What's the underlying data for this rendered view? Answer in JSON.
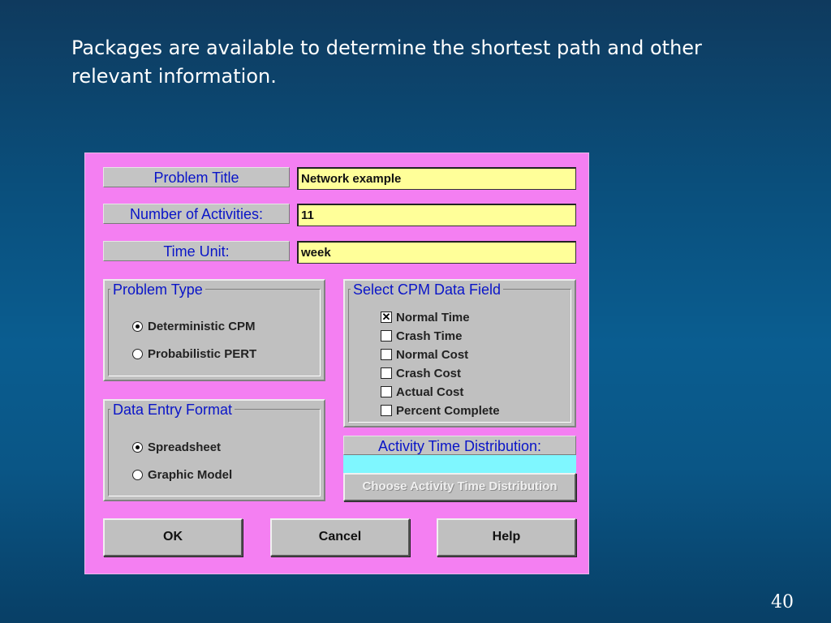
{
  "slide": {
    "text": "Packages are available to determine the shortest path and other relevant information.",
    "page_number": "40"
  },
  "dialog": {
    "problem_title_label": "Problem Title",
    "problem_title_value": "Network example",
    "num_activities_label": "Number of Activities:",
    "num_activities_value": "11",
    "time_unit_label": "Time Unit:",
    "time_unit_value": "week",
    "problem_type": {
      "title": "Problem Type",
      "options": [
        "Deterministic CPM",
        "Probabilistic PERT"
      ],
      "selected": "Deterministic CPM"
    },
    "cpm_data_field": {
      "title": "Select CPM Data Field",
      "options": [
        "Normal Time",
        "Crash Time",
        "Normal Cost",
        "Crash Cost",
        "Actual Cost",
        "Percent Complete"
      ],
      "checked": [
        "Normal Time"
      ]
    },
    "data_entry_format": {
      "title": "Data Entry Format",
      "options": [
        "Spreadsheet",
        "Graphic Model"
      ],
      "selected": "Spreadsheet"
    },
    "activity_time_distribution": {
      "label": "Activity Time Distribution:",
      "value": "",
      "choose_button": "Choose Activity Time Distribution"
    },
    "buttons": {
      "ok": "OK",
      "cancel": "Cancel",
      "help": "Help"
    }
  },
  "colors": {
    "dialog_background": "#f47ff2",
    "label_text": "#0a15c8",
    "input_background": "#ffff99",
    "distribution_field": "#7ff7ff",
    "panel_gray": "#c0c0c0"
  }
}
